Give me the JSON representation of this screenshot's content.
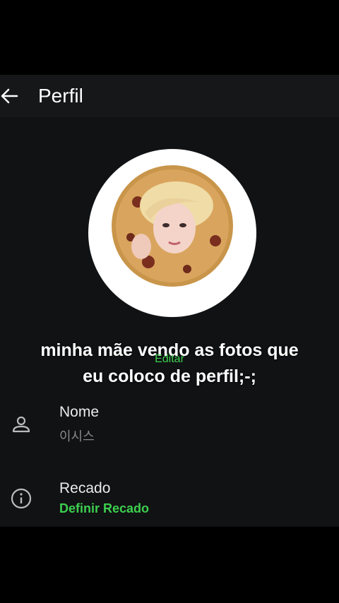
{
  "header": {
    "title": "Perfil",
    "back_icon": "arrow-left-icon"
  },
  "profile": {
    "edit_label": "Editar",
    "caption_line1": "minha mãe vendo as fotos que",
    "caption_line2": "eu coloco de perfil;-;"
  },
  "fields": [
    {
      "label": "Nome",
      "value": "이시스",
      "icon": "person-icon"
    },
    {
      "label": "Recado",
      "value": "Definir Recado",
      "icon": "info-icon"
    }
  ],
  "colors": {
    "accent": "#3ccf4e",
    "background": "#111214"
  }
}
